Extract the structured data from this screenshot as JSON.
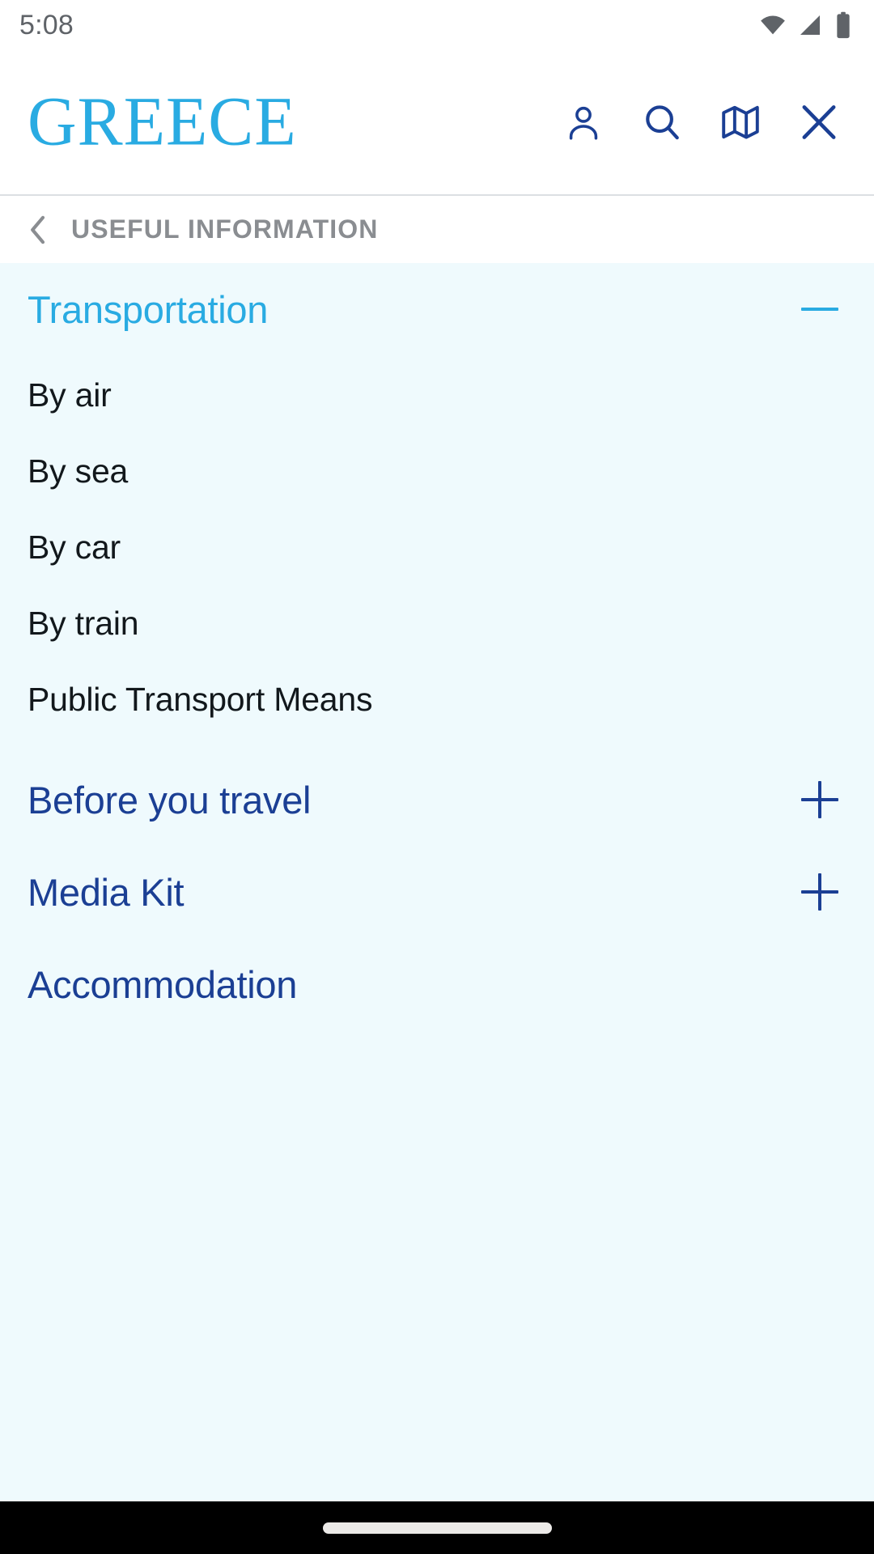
{
  "status_bar": {
    "time": "5:08",
    "icons": [
      "wifi-icon",
      "cellular-signal-icon",
      "battery-icon"
    ]
  },
  "header": {
    "brand": "GREECE",
    "brand_color": "#29abe2",
    "action_color": "#1b3f94",
    "actions": [
      {
        "name": "account-icon",
        "label": "Account"
      },
      {
        "name": "search-icon",
        "label": "Search"
      },
      {
        "name": "map-icon",
        "label": "Map"
      },
      {
        "name": "close-icon",
        "label": "Close"
      }
    ]
  },
  "breadcrumb": {
    "back_icon": "chevron-left-icon",
    "label": "USEFUL INFORMATION",
    "color": "#8a8d91"
  },
  "panel": {
    "background": "#effafd",
    "sections": [
      {
        "title": "Transportation",
        "expanded": true,
        "toggle": "minus-icon",
        "color": "#29abe2",
        "items": [
          "By air",
          "By sea",
          "By car",
          "By train",
          "Public Transport Means"
        ]
      },
      {
        "title": "Before you travel",
        "expanded": false,
        "toggle": "plus-icon",
        "color": "#1b3f94",
        "items": []
      },
      {
        "title": "Media Kit",
        "expanded": false,
        "toggle": "plus-icon",
        "color": "#1b3f94",
        "items": []
      }
    ],
    "links": [
      {
        "label": "Accommodation",
        "color": "#1b3f94"
      }
    ]
  },
  "nav_bar": {
    "home_indicator": "home-indicator-pill"
  }
}
